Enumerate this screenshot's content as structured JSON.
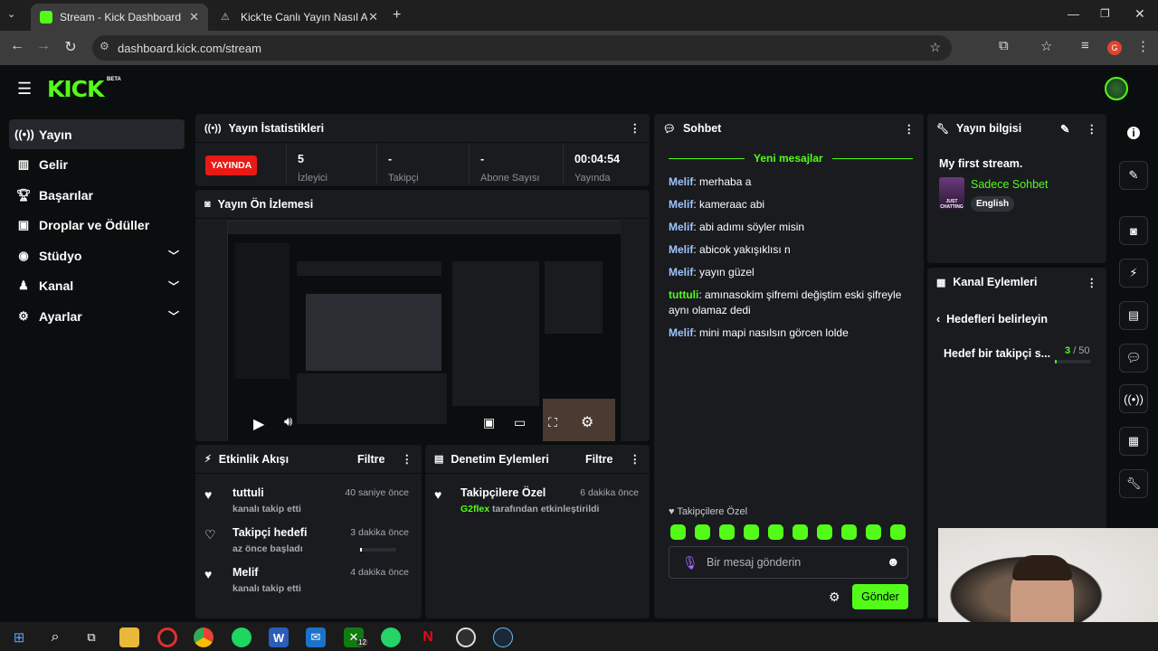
{
  "browser": {
    "tabs": [
      {
        "title": "Stream - Kick Dashboard",
        "active": true
      },
      {
        "title": "Kick'te Canlı Yayın Nasıl Açılır? |",
        "active": false
      }
    ],
    "url": "dashboard.kick.com/stream",
    "profile_initial": "G"
  },
  "app": {
    "logo": "KICK",
    "logo_badge": "BETA",
    "sidebar": {
      "items": [
        {
          "label": "Yayın",
          "icon": "broadcast-icon",
          "active": true,
          "chevron": false
        },
        {
          "label": "Gelir",
          "icon": "chart-icon",
          "active": false,
          "chevron": false
        },
        {
          "label": "Başarılar",
          "icon": "trophy-icon",
          "active": false,
          "chevron": false
        },
        {
          "label": "Droplar ve Ödüller",
          "icon": "gift-icon",
          "active": false,
          "chevron": false
        },
        {
          "label": "Stüdyo",
          "icon": "studio-icon",
          "active": false,
          "chevron": true
        },
        {
          "label": "Kanal",
          "icon": "users-icon",
          "active": false,
          "chevron": true
        },
        {
          "label": "Ayarlar",
          "icon": "gear-icon",
          "active": false,
          "chevron": true
        }
      ]
    },
    "stats": {
      "title": "Yayın İstatistikleri",
      "live_badge": "YAYINDA",
      "viewers_value": "5",
      "viewers_label": "İzleyici",
      "followers_value": "-",
      "followers_label": "Takipçi",
      "subs_value": "-",
      "subs_label": "Abone Sayısı",
      "time_value": "00:04:54",
      "time_label": "Yayında"
    },
    "preview": {
      "title": "Yayın Ön İzlemesi"
    },
    "activity": {
      "title": "Etkinlik Akışı",
      "filter": "Filtre",
      "items": [
        {
          "title": "tuttuli",
          "sub": "kanalı takip etti",
          "time": "40 saniye önce"
        },
        {
          "title": "Takipçi hedefi",
          "sub": "az önce başladı",
          "time": "3 dakika önce"
        },
        {
          "title": "Melif",
          "sub": "kanalı takip etti",
          "time": "4 dakika önce"
        }
      ]
    },
    "moderation": {
      "title": "Denetim Eylemleri",
      "filter": "Filtre",
      "item_title": "Takipçilere Özel",
      "item_time": "6 dakika önce",
      "item_user": "G2flex",
      "item_sub": "tarafından etkinleştirildi"
    },
    "chat": {
      "title": "Sohbet",
      "new_messages": "Yeni mesajlar",
      "messages": [
        {
          "user": "Melif",
          "text": "merhaba a"
        },
        {
          "user": "Melif",
          "text": "kameraac abi"
        },
        {
          "user": "Melif",
          "text": "abi adımı söyler misin"
        },
        {
          "user": "Melif",
          "text": "abicok yakışıklısı n"
        },
        {
          "user": "Melif",
          "text": "yayın güzel"
        },
        {
          "user": "tuttuli",
          "text": "amınasokim şifremi değiştim eski şifreyle aynı olamaz dedi"
        },
        {
          "user": "Melif",
          "text": "mini mapi nasılsın görcen lolde"
        }
      ],
      "mode_label": "Takipçilere Özel",
      "input_placeholder": "Bir mesaj gönderin",
      "send": "Gönder"
    },
    "stream_info": {
      "title": "Yayın bilgisi",
      "stream_title": "My first stream.",
      "category": "Sadece Sohbet",
      "language": "English",
      "thumb_text": "JUST CHATTING"
    },
    "channel_actions": {
      "title": "Kanal Eylemleri",
      "back_label": "Hedefleri belirleyin",
      "goal_label": "Hedef bir takipçi s...",
      "goal_current": "3",
      "goal_total": "/ 50",
      "goal_progress": 0.06
    },
    "colors": {
      "brand": "#53fc18",
      "live": "#e91916",
      "bg": "#0b0e0f",
      "panel": "#191b1f"
    }
  },
  "taskbar": {
    "badge": "12"
  }
}
